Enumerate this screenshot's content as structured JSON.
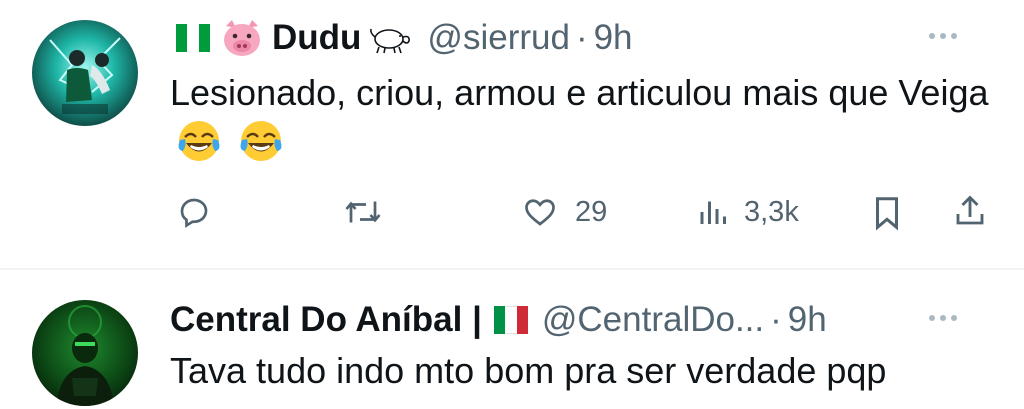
{
  "tweets": [
    {
      "display_name": "Dudu",
      "handle": "@sierrud",
      "separator": "·",
      "time": "9h",
      "text": "Lesionado, criou, armou e articulou mais que Veiga",
      "emojis": [
        "face-with-tears-of-joy",
        "face-with-tears-of-joy"
      ],
      "flag_colors": [
        "#009b3a",
        "#ffffff",
        "#009b3a"
      ],
      "actions": {
        "reply_icon": "reply-icon",
        "retweet_icon": "retweet-icon",
        "like_icon": "heart-icon",
        "like_count": "29",
        "views_icon": "views-icon",
        "views_count": "3,3k",
        "bookmark_icon": "bookmark-icon",
        "share_icon": "share-icon"
      }
    },
    {
      "display_name": "Central Do Aníbal |",
      "handle": "@CentralDo...",
      "separator": "·",
      "time": "9h",
      "text": "Tava tudo indo mto bom pra ser verdade pqp",
      "flag_colors": [
        "#009246",
        "#ffffff",
        "#ce2b37"
      ]
    }
  ]
}
